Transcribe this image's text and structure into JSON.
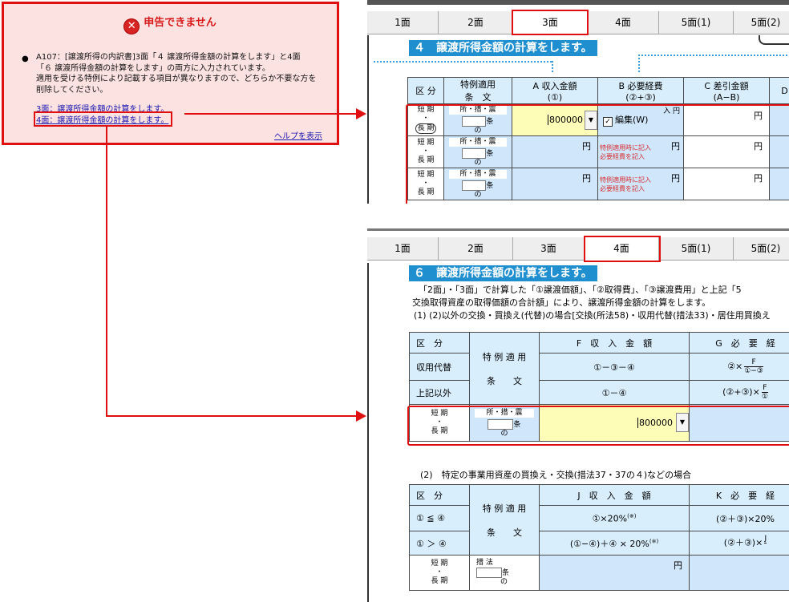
{
  "error": {
    "title": "申告できません",
    "line1": "A107：[譲渡所得の内訳書]3面「４ 譲渡所得金額の計算をします」と4面",
    "line2": "「６ 譲渡所得金額の計算をします」の両方に入力されています。",
    "line3": "適用を受ける特例により記載する項目が異なりますので、どちらか不要な方を",
    "line4": "削除してください。",
    "link3": "3面：譲渡所得金額の計算をします。",
    "link4": "4面：譲渡所得金額の計算をします。",
    "help": "ヘルプを表示"
  },
  "tabs": [
    "1面",
    "2面",
    "3面",
    "4面",
    "5面(1)",
    "5面(2)"
  ],
  "panel3": {
    "section_title": "４　譲渡所得金額の計算をします。",
    "col_kubun": "区 分",
    "col_tokurei1": "特例適用",
    "col_tokurei2": "条　文",
    "col_a1": "A 収入金額",
    "col_a2": "(①)",
    "col_b1": "B 必要経費",
    "col_b2": "(②+③)",
    "col_c1": "C 差引金額",
    "col_c2": "(A−B)",
    "col_d": "D",
    "tanki": "短 期",
    "choki": "長 期",
    "rule_text": "所・措・震",
    "jo": "条",
    "no": "の",
    "amount": "800000",
    "yen": "円",
    "edit_label": "編集(W)",
    "edit_trail": "入 円",
    "note1": "特例適用時に記入",
    "note2": "必要経費を記入"
  },
  "panel4": {
    "section_title": "６　譲渡所得金額の計算をします。",
    "desc1": "「2面」・「3面」で計算した「①譲渡価額」、「②取得費」、「③譲渡費用」と上記「5",
    "desc2": "交換取得資産の取得価額の合計額」により、譲渡所得金額の計算をします。",
    "desc3": "(1) (2)以外の交換・買換え(代替)の場合[交換(所法58)・収用代替(措法33)・居住用買換え",
    "kubun": "区　分",
    "shuyo": "収用代替",
    "jouki": "上記以外",
    "tokurei1": "特 例 適 用",
    "tokurei2": "条　　文",
    "f_head": "F　収　入　金　額",
    "f_row1": "①－③－④",
    "f_row2": "①－④",
    "g_head": "G　必　要　経",
    "g_row1": "②×",
    "g_frac_top": "F",
    "g_frac_bot": "①−③",
    "g_row2": "(②+③)×",
    "g_row2_frac": "F",
    "g_row2_bot": "①",
    "tanki": "短 期",
    "choki": "長 期",
    "rule_text": "所・措・震",
    "jo": "条",
    "no": "の",
    "amount": "800000",
    "sec2": "(2)　特定の事業用資産の買換え・交換(措法37・37の４)などの場合",
    "kubun2": "区　分",
    "cond1": "① ≦ ④",
    "cond2": "① ＞ ④",
    "j_head": "J　収　入　金　額",
    "j_row1": "①×20%",
    "j_row2": "(①−④)＋④ × 20%",
    "star": "(※)",
    "k_head": "K　必　要　経",
    "k_row1": "(②＋③)×20%",
    "k_row2": "(②＋③)×",
    "k_frac": "J",
    "sohou": "措 法",
    "yen": "円"
  }
}
